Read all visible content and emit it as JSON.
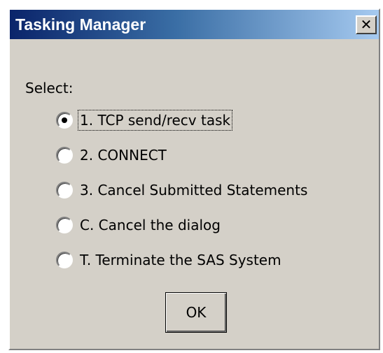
{
  "window": {
    "title": "Tasking Manager",
    "close_icon": "close-icon",
    "close_glyph": "✕"
  },
  "form": {
    "prompt": "Select:",
    "options": [
      {
        "label": "1. TCP send/recv task",
        "selected": true
      },
      {
        "label": "2. CONNECT",
        "selected": false
      },
      {
        "label": "3. Cancel Submitted Statements",
        "selected": false
      },
      {
        "label": "C. Cancel the dialog",
        "selected": false
      },
      {
        "label": "T. Terminate the SAS System",
        "selected": false
      }
    ],
    "ok_label": "OK"
  },
  "colors": {
    "titlebar_start": "#0a246a",
    "titlebar_end": "#a6caf0",
    "dialog_bg": "#d4d0c8"
  }
}
